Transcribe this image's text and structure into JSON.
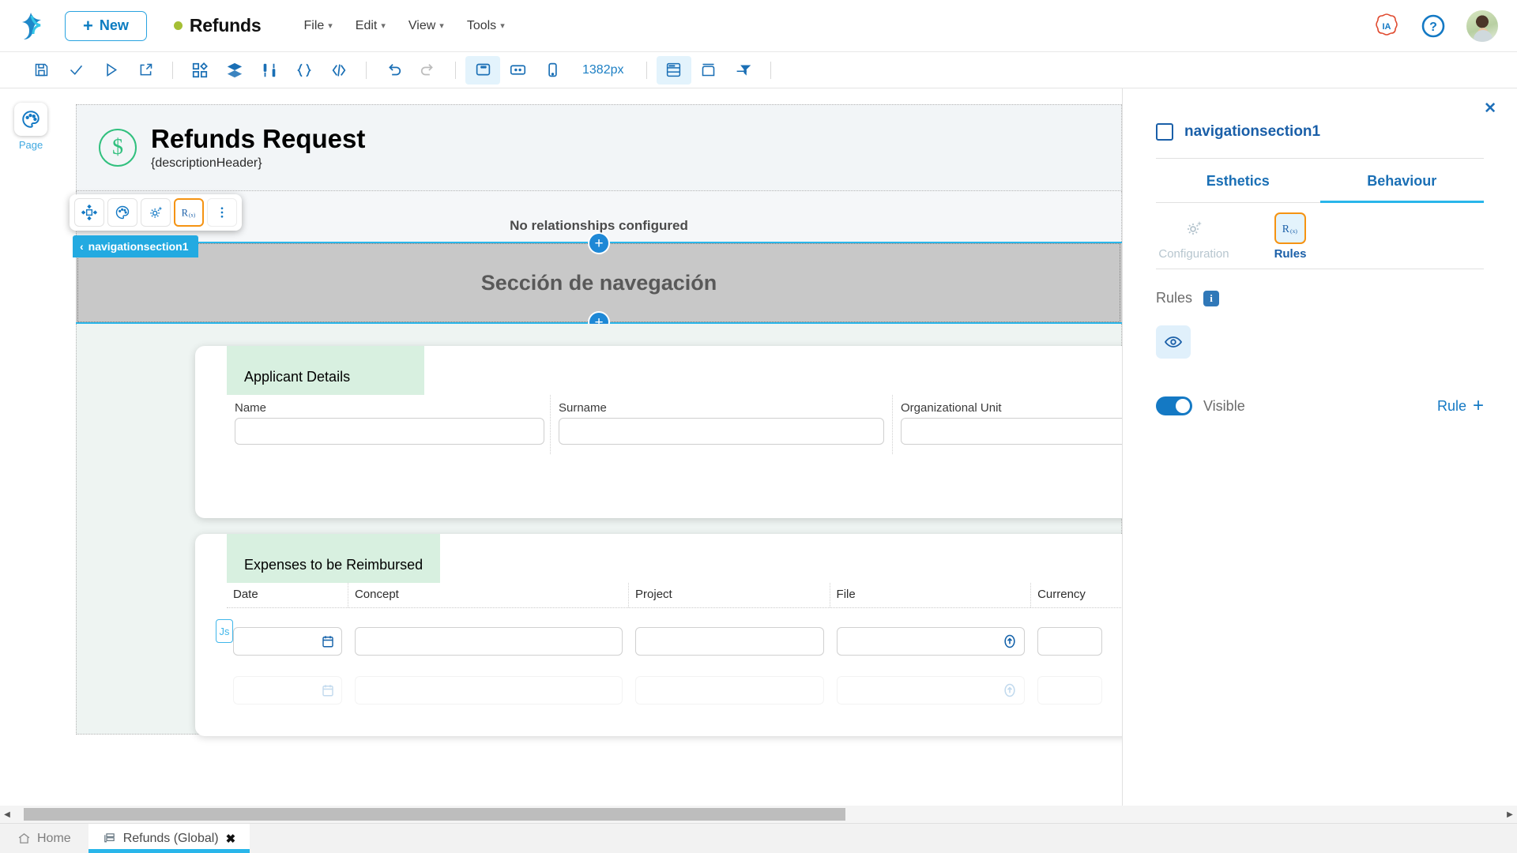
{
  "topbar": {
    "new_button": "New",
    "new_plus": "+",
    "app_title": "Refunds",
    "menus": [
      "File",
      "Edit",
      "View",
      "Tools"
    ],
    "ia_badge": "IA",
    "help": "?"
  },
  "toolbar": {
    "zoom_label": "1382px",
    "icons_group1": [
      "save-icon",
      "check-icon",
      "play-icon",
      "share-icon"
    ],
    "icons_group2": [
      "components-icon",
      "layers-icon",
      "settings-sliders-icon",
      "braces-icon",
      "code-icon"
    ],
    "icons_group3": [
      "undo-icon",
      "redo-icon"
    ],
    "icons_group4": [
      "desktop-icon",
      "tablet-icon",
      "mobile-icon"
    ],
    "icons_group5": [
      "grid-view-icon",
      "container-icon",
      "filter-icon"
    ]
  },
  "leftrail": {
    "items": [
      {
        "label": "Page",
        "icon": "palette-icon"
      }
    ]
  },
  "canvas": {
    "header": {
      "icon": "dollar-circle-icon",
      "title": "Refunds Request",
      "subtitle": "{descriptionHeader}"
    },
    "float_toolbar": {
      "buttons": [
        "move-icon",
        "palette-icon",
        "settings-sparkle-icon",
        "rules-rx-icon",
        "more-vertical-icon"
      ],
      "selected": "rules-rx-icon"
    },
    "selection_tag": {
      "chevron": "‹",
      "label": "navigationsection1"
    },
    "relationships_text": "No relationships configured",
    "nav_section_text": "Sección de navegación",
    "plus_node": "+",
    "applicant": {
      "section_title": "Applicant Details",
      "fields": [
        {
          "label": "Name",
          "value": ""
        },
        {
          "label": "Surname",
          "value": ""
        },
        {
          "label": "Organizational Unit",
          "value": ""
        }
      ]
    },
    "expenses": {
      "section_title": "Expenses to be Reimbursed",
      "columns": [
        "Date",
        "Concept",
        "Project",
        "File",
        "Currency"
      ],
      "js_chip": "Js",
      "rows": [
        {
          "date": "",
          "concept": "",
          "project": "",
          "file": "",
          "currency": "",
          "state": "active"
        },
        {
          "date": "",
          "concept": "",
          "project": "",
          "file": "",
          "currency": "",
          "state": "faded"
        }
      ]
    }
  },
  "right_panel": {
    "close": "✕",
    "element_name": "navigationsection1",
    "tabs": [
      {
        "label": "Esthetics",
        "active": false
      },
      {
        "label": "Behaviour",
        "active": true
      }
    ],
    "subtabs": [
      {
        "label": "Configuration",
        "icon": "settings-sparkle-icon",
        "active": false
      },
      {
        "label": "Rules",
        "icon": "rules-rx-icon",
        "active": true
      }
    ],
    "rules_label": "Rules",
    "info_badge": "i",
    "eye_icon": "eye-icon",
    "visible_label": "Visible",
    "visible_on": true,
    "rule_add_label": "Rule",
    "rule_add_plus": "+"
  },
  "bottom": {
    "scroll_left": "◀",
    "scroll_right": "▶",
    "home_label": "Home",
    "tab_label": "Refunds (Global)",
    "tab_close": "✖"
  },
  "colors": {
    "accent_blue": "#1479c4",
    "cyan": "#29b6ea",
    "orange": "#f59312",
    "green_dot": "#a5bf35",
    "section_green": "#d8f0e0"
  }
}
